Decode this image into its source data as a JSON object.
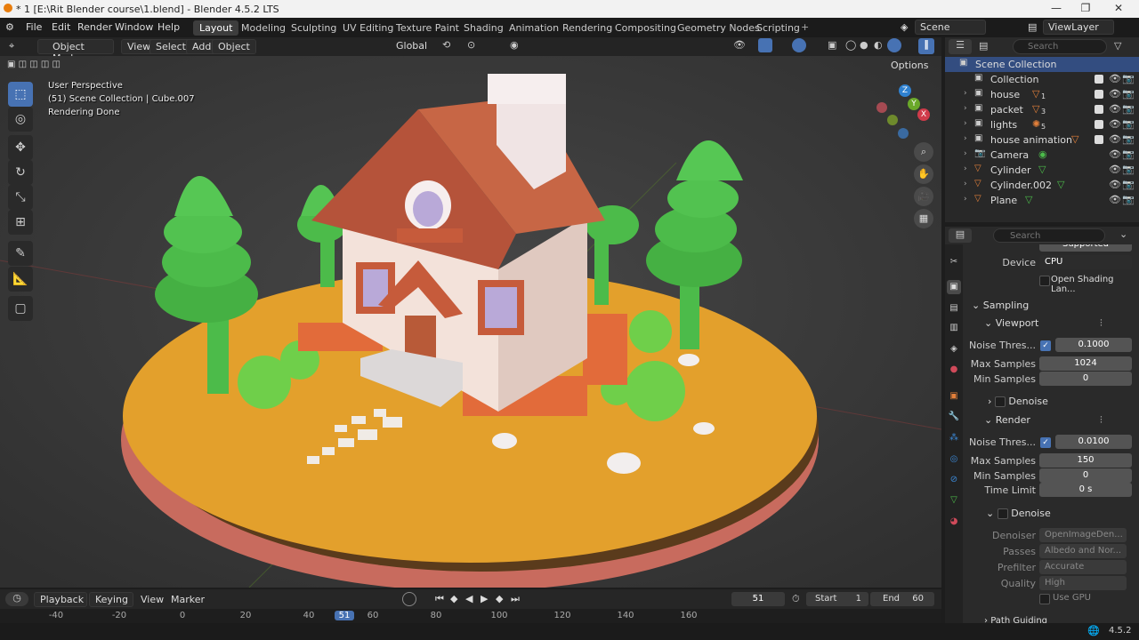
{
  "titlebar": {
    "title": "* 1 [E:\\Rit Blender course\\1.blend] - Blender 4.5.2 LTS"
  },
  "menu": [
    "File",
    "Edit",
    "Render",
    "Window",
    "Help"
  ],
  "workspaces": [
    "Layout",
    "Modeling",
    "Sculpting",
    "UV Editing",
    "Texture Paint",
    "Shading",
    "Animation",
    "Rendering",
    "Compositing",
    "Geometry Nodes",
    "Scripting"
  ],
  "topright": {
    "scene": "Scene",
    "view_layer": "ViewLayer"
  },
  "viewport_header": {
    "mode": "Object Mode",
    "menus": [
      "View",
      "Select",
      "Add",
      "Object"
    ],
    "orientation": "Global",
    "options": "Options"
  },
  "viewport_overlay": {
    "line1": "User Perspective",
    "line2": "(51) Scene Collection | Cube.007",
    "line3": "Rendering Done"
  },
  "gizmo": {
    "z": "Z",
    "y": "Y",
    "x": "X"
  },
  "outliner": {
    "search_placeholder": "Search",
    "root": "Scene Collection",
    "rows": [
      {
        "label": "Collection",
        "sub": ""
      },
      {
        "label": "house",
        "sub": "1"
      },
      {
        "label": "packet",
        "sub": "3"
      },
      {
        "label": "lights",
        "sub": "5"
      },
      {
        "label": "house animation",
        "sub": ""
      },
      {
        "label": "Camera",
        "sub": ""
      },
      {
        "label": "Cylinder",
        "sub": ""
      },
      {
        "label": "Cylinder.002",
        "sub": ""
      },
      {
        "label": "Plane",
        "sub": ""
      }
    ]
  },
  "properties": {
    "search_placeholder": "Search",
    "feature_set_value": "Supported",
    "device_label": "Device",
    "device_value": "CPU",
    "osl_label": "Open Shading Lan...",
    "sampling": "Sampling",
    "viewport": "Viewport",
    "vp_noise_label": "Noise Thres...",
    "vp_noise_value": "0.1000",
    "vp_max_label": "Max Samples",
    "vp_max_value": "1024",
    "vp_min_label": "Min Samples",
    "vp_min_value": "0",
    "vp_denoise": "Denoise",
    "render": "Render",
    "r_noise_label": "Noise Thres...",
    "r_noise_value": "0.0100",
    "r_max_label": "Max Samples",
    "r_max_value": "150",
    "r_min_label": "Min Samples",
    "r_min_value": "0",
    "r_time_label": "Time Limit",
    "r_time_value": "0 s",
    "r_denoise": "Denoise",
    "denoiser_label": "Denoiser",
    "denoiser_value": "OpenImageDen...",
    "passes_label": "Passes",
    "passes_value": "Albedo and Nor...",
    "prefilter_label": "Prefilter",
    "prefilter_value": "Accurate",
    "quality_label": "Quality",
    "quality_value": "High",
    "use_gpu": "Use GPU",
    "path_guiding": "Path Guiding"
  },
  "timeline": {
    "playback": "Playback",
    "keying": "Keying",
    "view": "View",
    "marker": "Marker",
    "current_frame": "51",
    "start_label": "Start",
    "start_value": "1",
    "end_label": "End",
    "end_value": "60",
    "ticks": [
      "-40",
      "-20",
      "0",
      "20",
      "40",
      "51",
      "60",
      "80",
      "100",
      "120",
      "140",
      "160"
    ]
  },
  "status": {
    "version": "4.5.2"
  },
  "colors": {
    "accent": "#4772b3",
    "ground": "#e3a02c",
    "house_roof": "#b5533a",
    "trees": "#4cbb4a"
  }
}
